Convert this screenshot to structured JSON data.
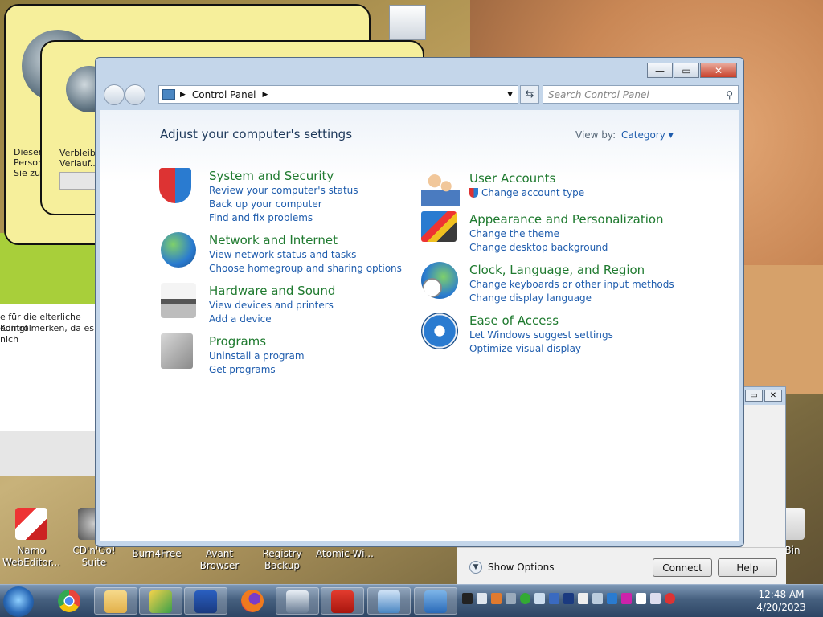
{
  "background_windows": {
    "back1_text": [
      "Dieser",
      "Person",
      "Sie zun"
    ],
    "back2_text": [
      "Verbleibe",
      "Verlauf..."
    ],
    "left_lines": [
      "e für die elterliche Kontrol",
      "edingt merken, da es nich"
    ]
  },
  "desktop_icons": [
    {
      "name": "namo-icon",
      "label": "Namo WebEditor..."
    },
    {
      "name": "cdngo-icon",
      "label": "CD'n'Go! Suite"
    },
    {
      "name": "burn4free-icon",
      "label": "Burn4Free"
    },
    {
      "name": "avant-icon",
      "label": "Avant Browser"
    },
    {
      "name": "registry-backup-icon",
      "label": "Registry Backup"
    },
    {
      "name": "atomic-icon",
      "label": "Atomic-Wi..."
    },
    {
      "name": "recycle-bin-icon",
      "label": "Bin"
    }
  ],
  "window": {
    "minimize": "—",
    "maximize": "▭",
    "close": "✕",
    "breadcrumb": "Control Panel",
    "search_placeholder": "Search Control Panel"
  },
  "content": {
    "heading": "Adjust your computer's settings",
    "view_by_label": "View by:",
    "view_by_value": "Category ▾",
    "left": [
      {
        "title": "System and Security",
        "links": [
          "Review your computer's status",
          "Back up your computer",
          "Find and fix problems"
        ]
      },
      {
        "title": "Network and Internet",
        "links": [
          "View network status and tasks",
          "Choose homegroup and sharing options"
        ]
      },
      {
        "title": "Hardware and Sound",
        "links": [
          "View devices and printers",
          "Add a device"
        ]
      },
      {
        "title": "Programs",
        "links": [
          "Uninstall a program",
          "Get programs"
        ]
      }
    ],
    "right": [
      {
        "title": "User Accounts",
        "links": [
          "Change account type"
        ]
      },
      {
        "title": "Appearance and Personalization",
        "links": [
          "Change the theme",
          "Change desktop background"
        ]
      },
      {
        "title": "Clock, Language, and Region",
        "links": [
          "Change keyboards or other input methods",
          "Change display language"
        ]
      },
      {
        "title": "Ease of Access",
        "links": [
          "Let Windows suggest settings",
          "Optimize visual display"
        ]
      }
    ]
  },
  "dialog": {
    "show_options": "Show Options",
    "connect": "Connect",
    "help": "Help"
  },
  "taskbar": {
    "time": "12:48 AM",
    "date": "4/20/2023",
    "colors": {
      "chrome": "#e8453c",
      "explorer": "#e8b84a",
      "firefox": "#f07a1e"
    }
  }
}
